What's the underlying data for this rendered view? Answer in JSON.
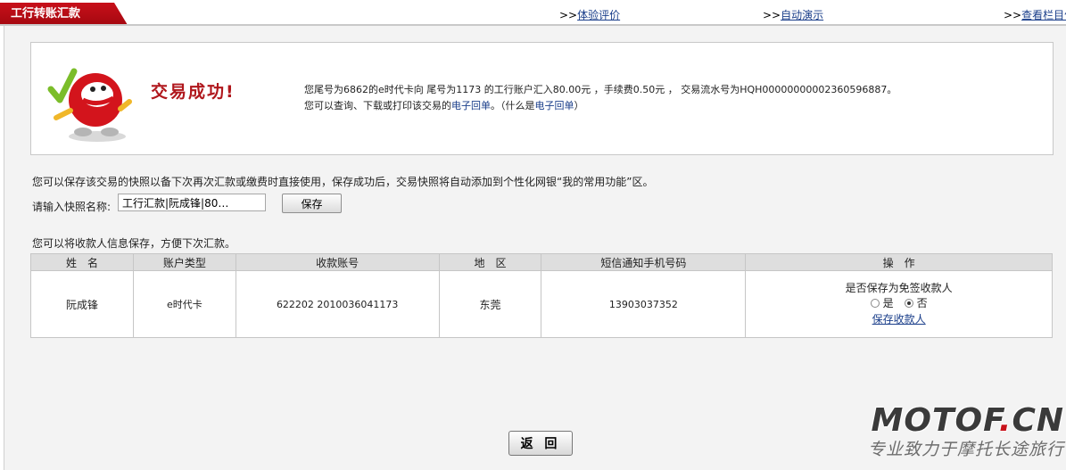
{
  "tab": {
    "title": "工行转账汇款"
  },
  "top_links": [
    {
      "prefix": ">>",
      "label": "体验评价"
    },
    {
      "prefix": ">>",
      "label": "自动演示"
    },
    {
      "prefix": ">>",
      "label": "查看栏目信"
    }
  ],
  "success": {
    "title": "交易成功!",
    "line1": "您尾号为6862的e时代卡向 尾号为1173 的工行账户汇入80.00元 ，手续费0.50元 ， 交易流水号为HQH00000000002360596887。",
    "line2_prefix": "您可以查询、下载或打印该交易的",
    "line2_link": "电子回单",
    "line2_mid": "。（什么是",
    "line2_link2": "电子回单",
    "line2_suffix": "）"
  },
  "quick_save": {
    "info": "您可以保存该交易的快照以备下次再次汇款或缴费时直接使用，保存成功后，交易快照将自动添加到个性化网银“我的常用功能”区。",
    "label": "请输入快照名称:",
    "input_value": "工行汇款|阮成锋|80…",
    "button": "保存"
  },
  "payee_info": "您可以将收款人信息保存，方便下次汇款。",
  "table": {
    "headers": [
      "姓　名",
      "账户类型",
      "收款账号",
      "地　区",
      "短信通知手机号码",
      "操　作"
    ],
    "row": {
      "name": "阮成锋",
      "account_type": "e时代卡",
      "account_no": "622202 2010036041173",
      "region": "东莞",
      "phone": "13903037352"
    },
    "op": {
      "question": "是否保存为免签收款人",
      "yes": "是",
      "no": "否",
      "selected": "否",
      "link": "保存收款人"
    }
  },
  "back_button": "返 回",
  "watermark": {
    "brand": "MOTOF",
    "dot": ".",
    "tld": "CN",
    "slogan": "专业致力于摩托长途旅行"
  },
  "colors": {
    "accent_red": "#b0171c",
    "link_blue": "#1a3e8a",
    "tab_red": "#c8101a"
  }
}
